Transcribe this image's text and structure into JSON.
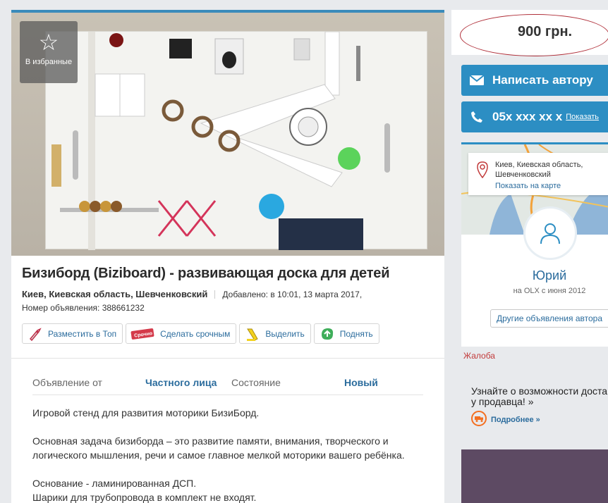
{
  "favorite": {
    "label": "В избранные",
    "icon": "star-icon"
  },
  "listing": {
    "title": "Бизиборд (Biziboard) - развивающая доска для детей",
    "location": "Киев, Киевская область, Шевченковский",
    "added": "Добавлено: в 10:01, 13 марта 2017,",
    "ad_number": "Номер объявления: 388661232"
  },
  "actions": [
    {
      "label": "Разместить в Топ",
      "icon": "rocket-icon"
    },
    {
      "label": "Сделать срочным",
      "icon": "urgent-label-icon",
      "badge": "Срочно"
    },
    {
      "label": "Выделить",
      "icon": "highlighter-icon"
    },
    {
      "label": "Поднять",
      "icon": "arrow-up-leaf-icon"
    }
  ],
  "props": {
    "from_key": "Объявление от",
    "from_val": "Частного лица",
    "state_key": "Состояние",
    "state_val": "Новый"
  },
  "description": [
    "Игровой стенд для развития моторики БизиБорд.",
    "Основная задача бизиборда – это развитие памяти, внимания, творческого и логического мышления, речи и самое главное мелкой моторики вашего ребёнка.",
    "Основание - ламинированная ДСП.",
    "Шарики для трубопровода в комплект не входят."
  ],
  "price": "900 грн.",
  "contact": {
    "message_label": "Написать автору",
    "phone": "05x xxx xx x",
    "show_label": "Показать"
  },
  "user": {
    "address": "Киев, Киевская область, Шевченковский",
    "map_link": "Показать на карте",
    "name": "Юрий",
    "since": "на OLX с июня 2012",
    "other_ads": "Другие объявления автора"
  },
  "complaint": "Жалоба",
  "promo": {
    "text_line1": "Узнайте о возможности доста",
    "text_line2": "у продавца! »",
    "link": "Подробнее »"
  },
  "colors": {
    "accent": "#2c8ec3",
    "link": "#2b6c9d",
    "complaint": "#c23b3b"
  }
}
